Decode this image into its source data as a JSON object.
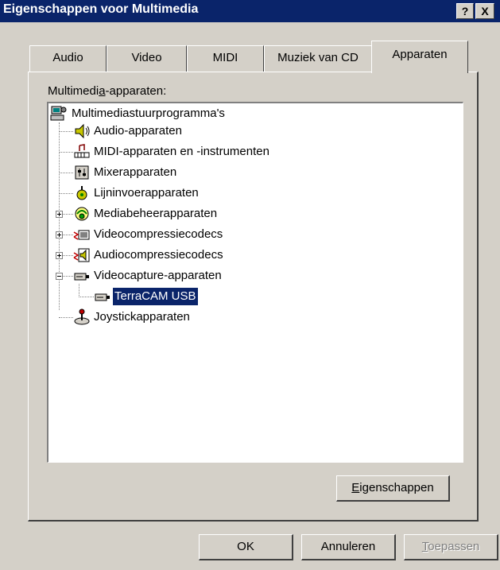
{
  "window": {
    "title": "Eigenschappen voor Multimedia",
    "help_label": "?",
    "close_label": "X"
  },
  "tabs": [
    {
      "label": "Audio",
      "active": false
    },
    {
      "label": "Video",
      "active": false
    },
    {
      "label": "MIDI",
      "active": false
    },
    {
      "label": "Muziek van CD",
      "active": false
    },
    {
      "label": "Apparaten",
      "active": true
    }
  ],
  "devices": {
    "label_pre": "Multimedi",
    "label_u": "a",
    "label_post": "-apparaten:",
    "tree": [
      {
        "label": "Multimediastuurprogramma's",
        "icon": "computer-icon"
      },
      {
        "label": "Audio-apparaten",
        "icon": "speaker-icon"
      },
      {
        "label": "MIDI-apparaten en -instrumenten",
        "icon": "midi-icon"
      },
      {
        "label": "Mixerapparaten",
        "icon": "mixer-icon"
      },
      {
        "label": "Lijninvoerapparaten",
        "icon": "line-in-icon"
      },
      {
        "label": "Mediabeheerapparaten",
        "icon": "media-control-icon",
        "expander": "plus"
      },
      {
        "label": "Videocompressiecodecs",
        "icon": "video-codec-icon",
        "expander": "plus"
      },
      {
        "label": "Audiocompressiecodecs",
        "icon": "audio-codec-icon",
        "expander": "plus"
      },
      {
        "label": "Videocapture-apparaten",
        "icon": "video-capture-icon",
        "expander": "minus"
      },
      {
        "label": "TerraCAM USB",
        "icon": "camera-icon",
        "selected": true
      },
      {
        "label": "Joystickapparaten",
        "icon": "joystick-icon"
      }
    ]
  },
  "buttons": {
    "properties_u": "E",
    "properties_rest": "igenschappen",
    "ok": "OK",
    "cancel": "Annuleren",
    "apply_u": "T",
    "apply_rest": "oepassen"
  },
  "colors": {
    "titlebar": "#0a246a",
    "face": "#d4d0c8",
    "selection": "#0a246a"
  }
}
